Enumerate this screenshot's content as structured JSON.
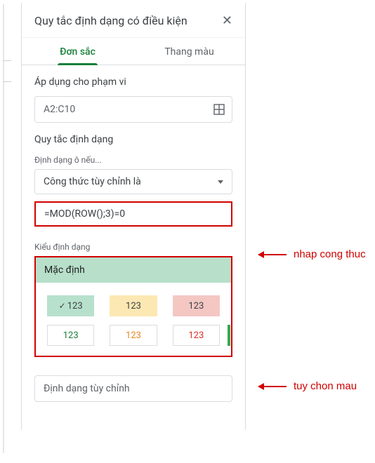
{
  "panel": {
    "title": "Quy tắc định dạng có điều kiện",
    "tabs": {
      "single": "Đơn sắc",
      "scale": "Thang màu"
    },
    "range": {
      "label": "Áp dụng cho phạm vi",
      "value": "A2:C10"
    },
    "rules": {
      "label": "Quy tắc định dạng",
      "condition_sub": "Định dạng ô nếu...",
      "condition_value": "Công thức tùy chỉnh là",
      "formula": "=MOD(ROW();3)=0"
    },
    "style": {
      "sub": "Kiểu định dạng",
      "default_label": "Mặc định",
      "swatches": {
        "a": "123",
        "b": "123",
        "c": "123",
        "d": "123",
        "e": "123",
        "f": "123",
        "check": "✓"
      }
    },
    "custom": "Định dạng tùy chỉnh"
  },
  "annotations": {
    "formula": "nhap cong thuc",
    "style": "tuy chon mau"
  }
}
